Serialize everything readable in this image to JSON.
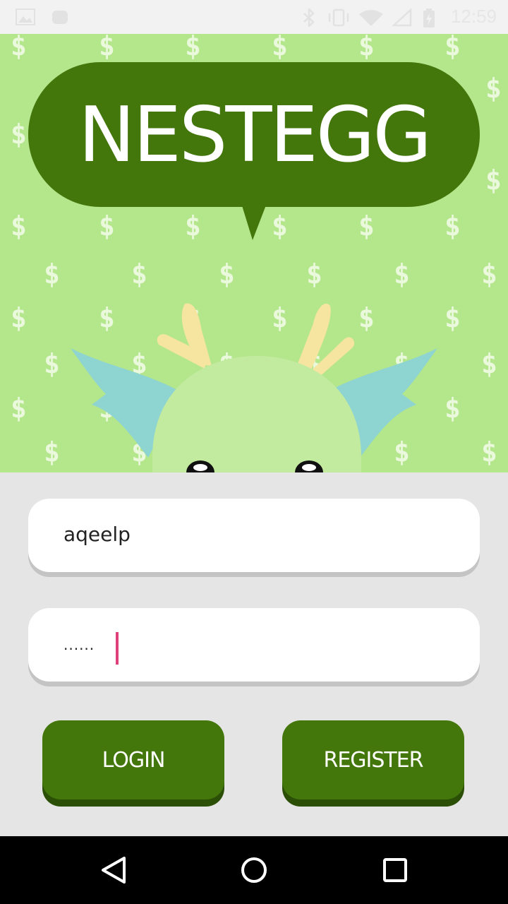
{
  "status_bar": {
    "time": "12:59",
    "icons": [
      "image-icon",
      "android-icon",
      "bluetooth-icon",
      "vibrate-icon",
      "wifi-icon",
      "signal-icon",
      "battery-icon"
    ]
  },
  "hero": {
    "logo_text": "NESTEGG",
    "pattern_glyph": "$",
    "colors": {
      "background": "#b4e68c",
      "bubble": "#43760b",
      "dragon": "#c3eb9f",
      "horns": "#f5e5a0",
      "fins": "#8ed4d0"
    }
  },
  "login": {
    "username_value": "aqeelp",
    "password_value": "......",
    "login_label": "LOGIN",
    "register_label": "REGISTER",
    "colors": {
      "button": "#43760b",
      "cursor": "#e0407a"
    }
  },
  "nav_bar": {
    "icons": [
      "back-icon",
      "home-icon",
      "recents-icon"
    ]
  }
}
